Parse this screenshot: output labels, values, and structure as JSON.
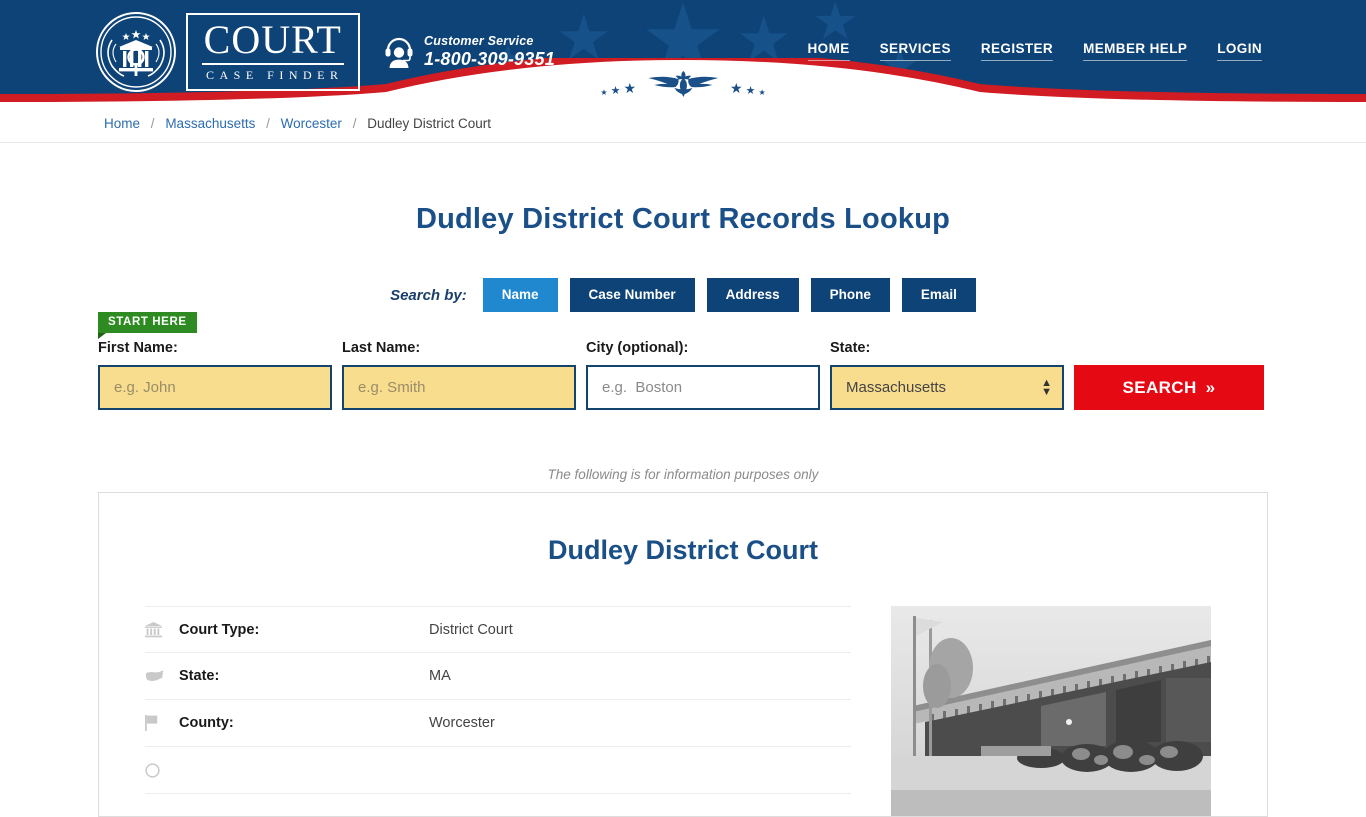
{
  "header": {
    "logo": {
      "main": "COURT",
      "sub": "CASE FINDER",
      "seal_icon": "court-seal-icon"
    },
    "customer_service": {
      "label": "Customer Service",
      "phone": "1-800-309-9351",
      "icon": "headset-support-icon"
    },
    "nav": [
      {
        "label": "HOME"
      },
      {
        "label": "SERVICES"
      },
      {
        "label": "REGISTER"
      },
      {
        "label": "MEMBER HELP"
      },
      {
        "label": "LOGIN"
      }
    ],
    "banner_icon": "eagle-emblem-icon",
    "colors": {
      "navy": "#0e4377",
      "red": "#d01c22",
      "white": "#ffffff"
    }
  },
  "breadcrumb": {
    "items": [
      {
        "label": "Home",
        "current": false
      },
      {
        "label": "Massachusetts",
        "current": false
      },
      {
        "label": "Worcester",
        "current": false
      },
      {
        "label": "Dudley District Court",
        "current": true
      }
    ],
    "separator": "/"
  },
  "page": {
    "title": "Dudley District Court Records Lookup",
    "disclaimer": "The following is for information purposes only"
  },
  "search": {
    "search_by_label": "Search by:",
    "tabs": [
      {
        "label": "Name",
        "active": true
      },
      {
        "label": "Case Number",
        "active": false
      },
      {
        "label": "Address",
        "active": false
      },
      {
        "label": "Phone",
        "active": false
      },
      {
        "label": "Email",
        "active": false
      }
    ],
    "start_here_badge": "START HERE",
    "fields": {
      "first_name": {
        "label": "First Name:",
        "placeholder": "e.g. John",
        "value": ""
      },
      "last_name": {
        "label": "Last Name:",
        "placeholder": "e.g. Smith",
        "value": ""
      },
      "city": {
        "label": "City (optional):",
        "placeholder": "e.g.  Boston",
        "value": ""
      },
      "state": {
        "label": "State:",
        "value": "Massachusetts"
      }
    },
    "submit_label": "SEARCH",
    "submit_arrow": "»",
    "colors": {
      "active_tab": "#2088ce",
      "tab": "#0e4377",
      "submit": "#e50914",
      "field_yellow": "#f8dd8e",
      "badge_green": "#2e8b21"
    }
  },
  "court": {
    "name": "Dudley District Court",
    "rows": [
      {
        "icon": "bank-building-icon",
        "label": "Court Type:",
        "value": "District Court"
      },
      {
        "icon": "us-map-icon",
        "label": "State:",
        "value": "MA"
      },
      {
        "icon": "flag-icon",
        "label": "County:",
        "value": "Worcester"
      }
    ],
    "photo_alt": "courthouse-photo"
  }
}
